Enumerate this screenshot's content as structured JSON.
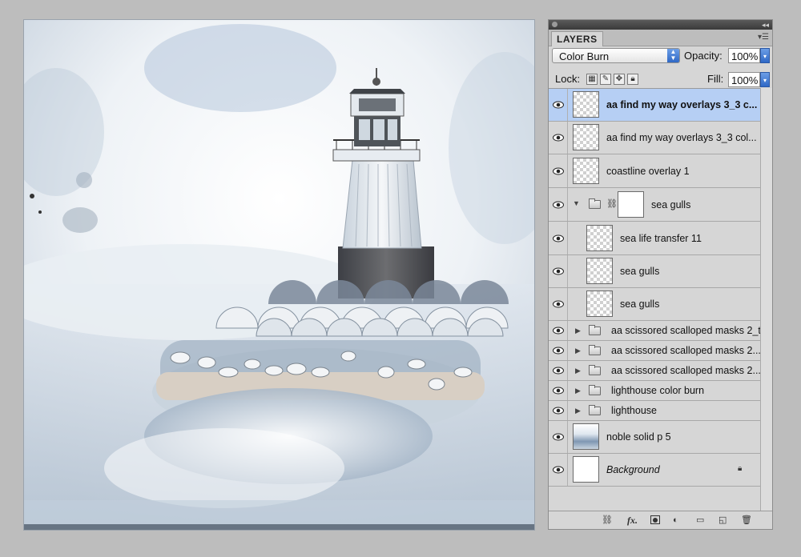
{
  "layers_panel": {
    "tab_label": "LAYERS",
    "blend_mode": "Color Burn",
    "opacity_label": "Opacity:",
    "opacity_value": "100%",
    "lock_label": "Lock:",
    "fill_label": "Fill:",
    "fill_value": "100%",
    "layers": [
      {
        "name": "aa find my way overlays 3_3 c...",
        "selected": true
      },
      {
        "name": "aa find my way overlays 3_3 col..."
      },
      {
        "name": "coastline overlay 1"
      },
      {
        "name": "sea gulls",
        "type": "group-expanded"
      },
      {
        "name": "sea life transfer 11"
      },
      {
        "name": "sea gulls"
      },
      {
        "name": "sea gulls"
      },
      {
        "name": "aa scissored scalloped masks 2_t"
      },
      {
        "name": "aa scissored scalloped masks 2..."
      },
      {
        "name": "aa scissored scalloped masks 2..."
      },
      {
        "name": "lighthouse color burn"
      },
      {
        "name": "lighthouse"
      },
      {
        "name": "noble solid p 5"
      },
      {
        "name": "Background"
      }
    ],
    "bottom_icons": [
      "link-icon",
      "fx-icon",
      "mask-icon",
      "adjustment-icon",
      "new-group-icon",
      "new-layer-icon",
      "trash-icon"
    ],
    "fx_label": "fx."
  },
  "colors": {
    "selection": "#b6cff4",
    "panel_bg": "#d6d6d6",
    "app_bg": "#bdbdbd"
  }
}
